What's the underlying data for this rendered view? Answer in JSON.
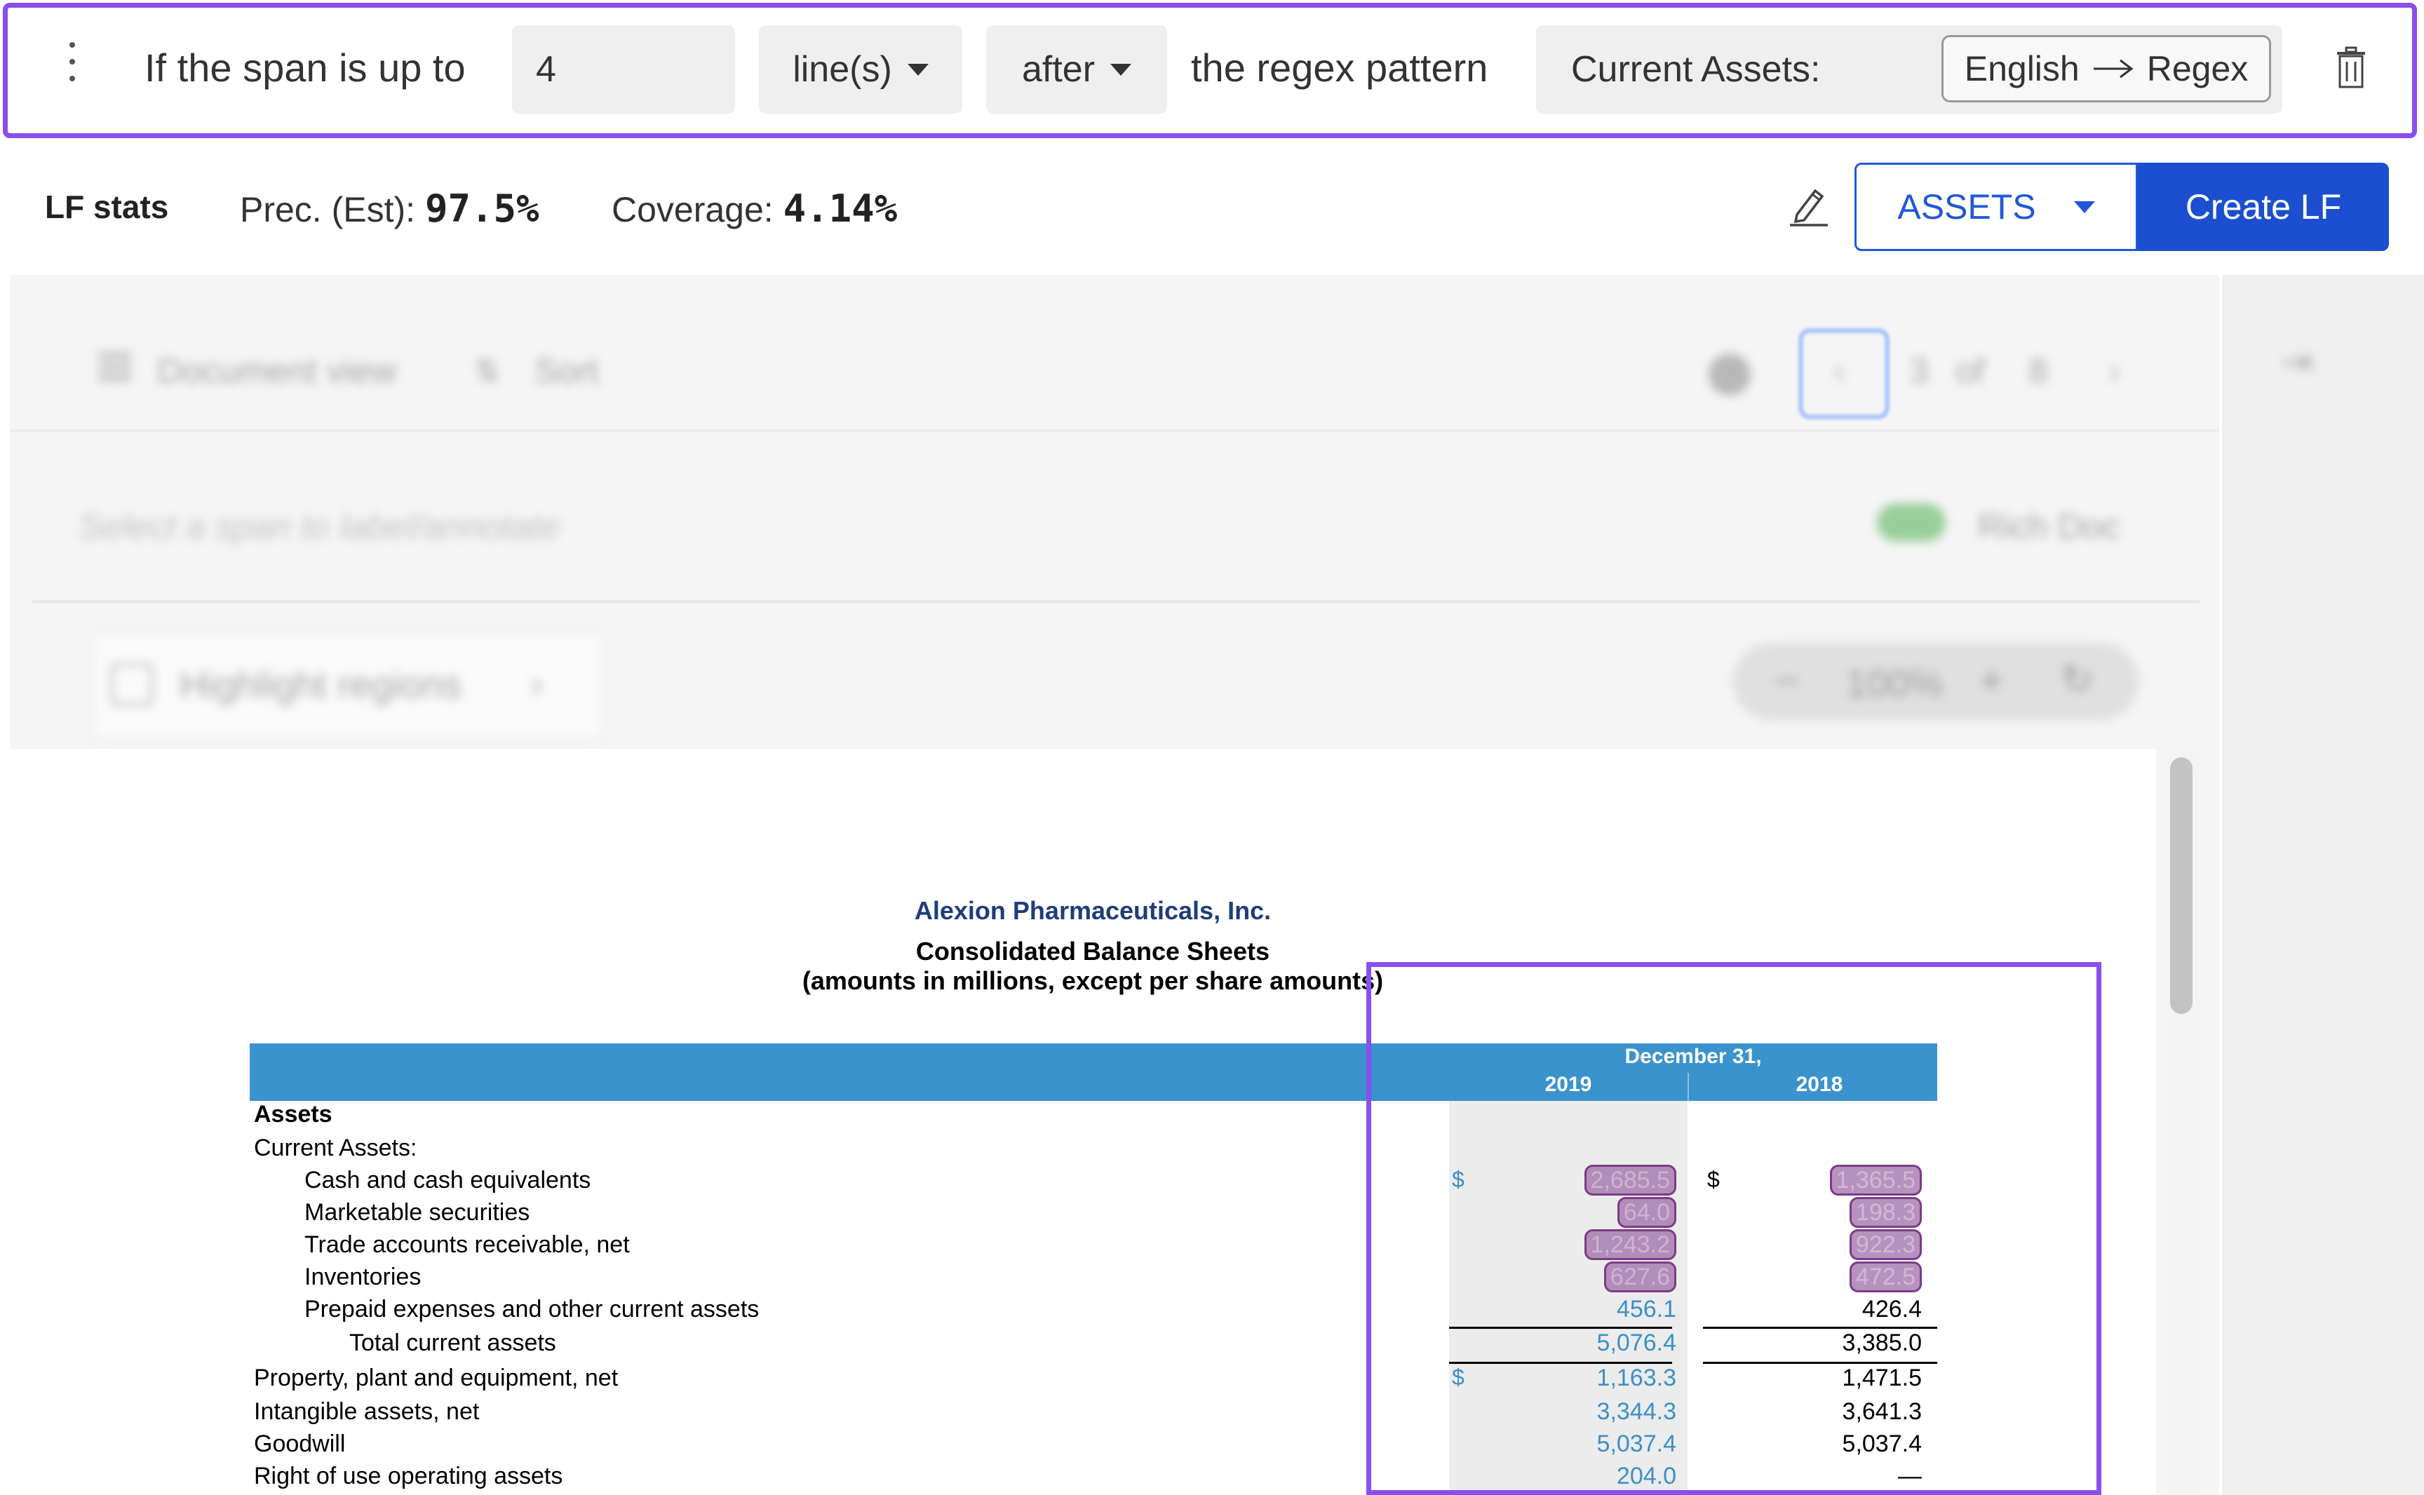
{
  "lf_bar": {
    "prefix_text": "If the span is up to",
    "count_value": "4",
    "unit_label": "line(s)",
    "direction_label": "after",
    "pattern_text": "the regex pattern",
    "pattern_value": "Current Assets:",
    "mode_from": "English",
    "mode_to": "Regex"
  },
  "stats": {
    "title": "LF stats",
    "precision_label": "Prec. (Est):",
    "precision_value": "97.5%",
    "coverage_label": "Coverage:",
    "coverage_value": "4.14%",
    "label_select": "ASSETS",
    "create_label": "Create LF"
  },
  "toolbar": {
    "view_label": "Document view",
    "sort_label": "Sort",
    "page_current": "3",
    "page_of": "of",
    "page_total": "8",
    "hint": "Select a span to label/annotate",
    "rich_doc_label": "Rich Doc",
    "highlight_label": "Highlight regions",
    "zoom_value": "100%"
  },
  "document": {
    "company": "Alexion Pharmaceuticals, Inc.",
    "title": "Consolidated Balance Sheets",
    "subtitle": "(amounts in millions, except per share amounts)",
    "header_date": "December 31,",
    "year_a": "2019",
    "year_b": "2018",
    "section": "Assets",
    "subsection": "Current Assets:",
    "rows": [
      {
        "label": "Cash and cash equivalents",
        "cur_a": "$",
        "a": "2,685.5",
        "cur_b": "$",
        "b": "1,365.5"
      },
      {
        "label": "Marketable securities",
        "a": "64.0",
        "b": "198.3"
      },
      {
        "label": "Trade accounts receivable, net",
        "a": "1,243.2",
        "b": "922.3"
      },
      {
        "label": "Inventories",
        "a": "627.6",
        "b": "472.5"
      },
      {
        "label": "Prepaid expenses and other current assets",
        "a": "456.1",
        "b": "426.4"
      },
      {
        "label": "Total current assets",
        "a": "5,076.4",
        "b": "3,385.0"
      },
      {
        "label": "Property, plant and equipment, net",
        "cur_a": "$",
        "a": "1,163.3",
        "b": "1,471.5"
      },
      {
        "label": "Intangible assets, net",
        "a": "3,344.3",
        "b": "3,641.3"
      },
      {
        "label": "Goodwill",
        "a": "5,037.4",
        "b": "5,037.4"
      },
      {
        "label": "Right of use operating assets",
        "a": "204.0",
        "b": "—"
      }
    ]
  },
  "colors": {
    "accent_purple": "#8b4ef0",
    "primary_blue": "#1b4fd0",
    "table_header_blue": "#3a93cd",
    "highlight_mauve": "#a06eaa"
  }
}
